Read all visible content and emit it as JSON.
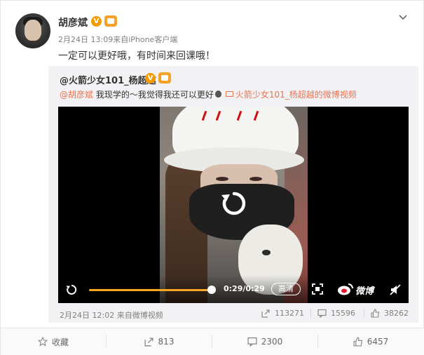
{
  "post": {
    "author": "胡彦斌",
    "verified_badge": "V",
    "meta": "2月24日 13:09来自iPhone客户端",
    "text": "一定可以更好哦，有时间来回课哦！"
  },
  "repost": {
    "user": "@火箭少女101_杨超越",
    "verified_badge": "V",
    "mention": "@胡彦斌",
    "text_body": " 我现学的～我觉得我还可以更好",
    "link_text": "火箭少女101_杨超越的微博视频",
    "video": {
      "time_display": "0:29/0:29",
      "progress": 1.0,
      "quality_button": "高清",
      "brand_text": "微博"
    },
    "meta": "2月24日 12:02 来自微博视频",
    "stats": {
      "reposts": "113271",
      "comments": "15596",
      "likes": "38262"
    }
  },
  "footer": {
    "favorite": "收藏",
    "reposts": "813",
    "comments": "2300",
    "likes": "6457"
  }
}
